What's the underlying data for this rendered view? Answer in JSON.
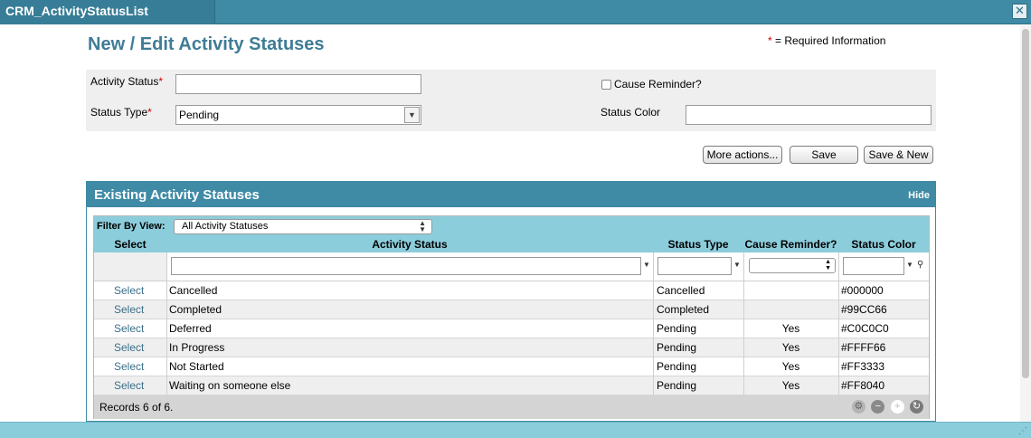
{
  "window": {
    "title": "CRM_ActivityStatusList",
    "close_glyph": "✕"
  },
  "page": {
    "title": "New / Edit Activity Statuses",
    "required_star": "*",
    "required_text": "= Required Information"
  },
  "form": {
    "activity_status_label": "Activity Status",
    "status_type_label": "Status Type",
    "status_type_value": "Pending",
    "cause_reminder_label": "Cause Reminder?",
    "status_color_label": "Status Color",
    "required_mark": "*"
  },
  "buttons": {
    "more_actions": "More actions...",
    "save": "Save",
    "save_new": "Save & New"
  },
  "panel": {
    "title": "Existing Activity Statuses",
    "hide": "Hide"
  },
  "grid": {
    "filter_label": "Filter By View:",
    "filter_value": "All Activity Statuses",
    "columns": [
      "Select",
      "Activity Status",
      "Status Type",
      "Cause Reminder?",
      "Status Color"
    ],
    "rows": [
      {
        "select": "Select",
        "status": "Cancelled",
        "type": "Cancelled",
        "reminder": "",
        "color": "#000000"
      },
      {
        "select": "Select",
        "status": "Completed",
        "type": "Completed",
        "reminder": "",
        "color": "#99CC66"
      },
      {
        "select": "Select",
        "status": "Deferred",
        "type": "Pending",
        "reminder": "Yes",
        "color": "#C0C0C0"
      },
      {
        "select": "Select",
        "status": "In Progress",
        "type": "Pending",
        "reminder": "Yes",
        "color": "#FFFF66"
      },
      {
        "select": "Select",
        "status": "Not Started",
        "type": "Pending",
        "reminder": "Yes",
        "color": "#FF3333"
      },
      {
        "select": "Select",
        "status": "Waiting on someone else",
        "type": "Pending",
        "reminder": "Yes",
        "color": "#FF8040"
      }
    ],
    "records_text": "Records 6 of 6."
  },
  "colors": {
    "accent": "#3f8aa5",
    "header_bg": "#8ccddc",
    "title_text": "#3f7c96",
    "required": "#cc0000"
  }
}
